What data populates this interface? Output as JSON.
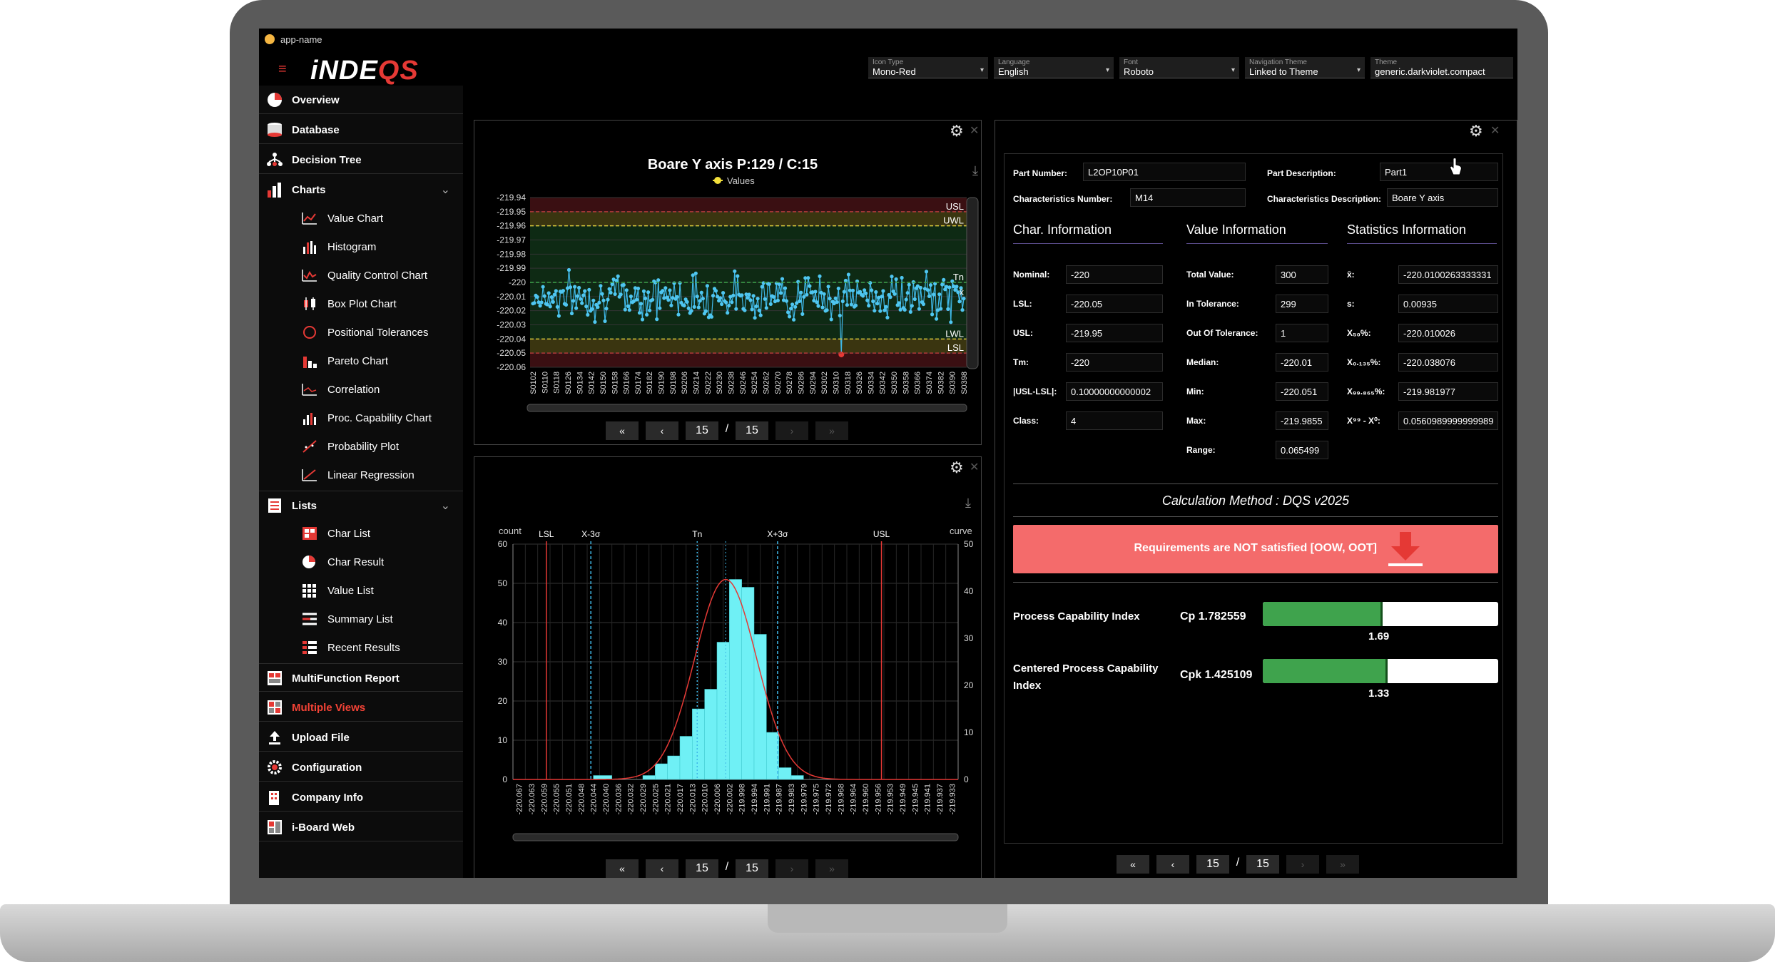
{
  "app": {
    "title": "app-name",
    "logo_main": "iNDE",
    "logo_accent": "QS"
  },
  "top_selectors": [
    {
      "label": "Icon Type",
      "value": "Mono-Red"
    },
    {
      "label": "Language",
      "value": "English"
    },
    {
      "label": "Font",
      "value": "Roboto"
    },
    {
      "label": "Navigation Theme",
      "value": "Linked to Theme"
    },
    {
      "label": "Theme",
      "value": "generic.darkviolet.compact"
    }
  ],
  "sidebar": {
    "overview": "Overview",
    "database": "Database",
    "decision_tree": "Decision Tree",
    "charts": "Charts",
    "chart_items": [
      "Value Chart",
      "Histogram",
      "Quality Control Chart",
      "Box Plot Chart",
      "Positional Tolerances",
      "Pareto Chart",
      "Correlation",
      "Proc. Capability Chart",
      "Probability Plot",
      "Linear Regression"
    ],
    "lists": "Lists",
    "list_items": [
      "Char List",
      "Char Result",
      "Value List",
      "Summary List",
      "Recent Results"
    ],
    "multifunction": "MultiFunction Report",
    "multiple_views": "Multiple Views",
    "upload": "Upload File",
    "configuration": "Configuration",
    "company": "Company Info",
    "iboard": "i-Board Web"
  },
  "value_chart": {
    "title": "Boare Y axis P:129 / C:15",
    "legend": "Values",
    "y_ticks": [
      "-219.94",
      "-219.95",
      "-219.96",
      "-219.97",
      "-219.98",
      "-219.99",
      "-220",
      "-220.01",
      "-220.02",
      "-220.03",
      "-220.04",
      "-220.05",
      "-220.06"
    ],
    "x_ticks": [
      "S0102",
      "S0110",
      "S0118",
      "S0126",
      "S0134",
      "S0142",
      "S0150",
      "S0158",
      "S0166",
      "S0174",
      "S0182",
      "S0190",
      "S0198",
      "S0206",
      "S0214",
      "S0222",
      "S0230",
      "S0238",
      "S0246",
      "S0254",
      "S0262",
      "S0270",
      "S0278",
      "S0286",
      "S0294",
      "S0302",
      "S0310",
      "S0318",
      "S0326",
      "S0334",
      "S0342",
      "S0350",
      "S0358",
      "S0366",
      "S0374",
      "S0382",
      "S0390",
      "S0398"
    ],
    "line_labels": {
      "usl": "USL",
      "uwl": "UWL",
      "tn": "Tn",
      "x": "x̄",
      "lwl": "LWL",
      "lsl": "LSL"
    },
    "pager": {
      "first": "«",
      "prev": "‹",
      "current": "15",
      "sep": "/",
      "total": "15",
      "next": "›",
      "last": "»"
    }
  },
  "histogram": {
    "left_axis_title": "count",
    "right_axis_title": "curve",
    "left_ticks": [
      "60",
      "50",
      "40",
      "30",
      "20",
      "10",
      "0"
    ],
    "right_ticks": [
      "50",
      "40",
      "30",
      "20",
      "10",
      "0"
    ],
    "vlines": {
      "lsl": "LSL",
      "xm3": "X-3σ",
      "tn": "Tn",
      "xp3": "X+3σ",
      "usl": "USL"
    },
    "x_ticks": [
      "-220.067",
      "-220.063",
      "-220.059",
      "-220.055",
      "-220.051",
      "-220.048",
      "-220.044",
      "-220.040",
      "-220.036",
      "-220.032",
      "-220.029",
      "-220.025",
      "-220.021",
      "-220.017",
      "-220.013",
      "-220.010",
      "-220.006",
      "-220.002",
      "-219.998",
      "-219.994",
      "-219.991",
      "-219.987",
      "-219.983",
      "-219.979",
      "-219.975",
      "-219.972",
      "-219.968",
      "-219.964",
      "-219.960",
      "-219.956",
      "-219.953",
      "-219.949",
      "-219.945",
      "-219.941",
      "-219.937",
      "-219.933"
    ],
    "pager": {
      "first": "«",
      "prev": "‹",
      "current": "15",
      "sep": "/",
      "total": "15",
      "next": "›",
      "last": "»"
    }
  },
  "chart_data": [
    {
      "type": "line",
      "title": "Boare Y axis P:129 / C:15",
      "series": [
        {
          "name": "Values"
        }
      ],
      "ylim": [
        -220.06,
        -219.94
      ],
      "limits": {
        "USL": -219.95,
        "UWL": -219.96,
        "Tn": -220.0,
        "LWL": -220.04,
        "LSL": -220.05
      },
      "x_range": [
        "S0102",
        "S0398"
      ]
    },
    {
      "type": "bar",
      "xlabel": "",
      "ylabel": "count",
      "y2label": "curve",
      "ylim": [
        0,
        60
      ],
      "y2lim": [
        0,
        50
      ],
      "categories": [
        "-220.051",
        "-220.036",
        "-220.032",
        "-220.029",
        "-220.025",
        "-220.021",
        "-220.017",
        "-220.013",
        "-220.010",
        "-220.006",
        "-220.002",
        "-219.998",
        "-219.994",
        "-219.991"
      ],
      "values": [
        1,
        1,
        4,
        6,
        11,
        18,
        23,
        35,
        51,
        49,
        37,
        12,
        3,
        1
      ],
      "vlines": {
        "LSL": -220.05,
        "X-3σ": -220.038,
        "Tn": -220.0,
        "X+3σ": -219.982,
        "USL": -219.95
      }
    }
  ],
  "info": {
    "part_number_label": "Part Number:",
    "part_number": "L2OP10P01",
    "part_desc_label": "Part Description:",
    "part_desc": "Part1",
    "char_number_label": "Characteristics Number:",
    "char_number": "M14",
    "char_desc_label": "Characteristics Description:",
    "char_desc": "Boare Y axis",
    "sec_char": "Char. Information",
    "sec_value": "Value Information",
    "sec_stats": "Statistics Information",
    "char_rows": [
      {
        "label": "Nominal:",
        "value": "-220"
      },
      {
        "label": "LSL:",
        "value": "-220.05"
      },
      {
        "label": "USL:",
        "value": "-219.95"
      },
      {
        "label": "Tm:",
        "value": "-220"
      },
      {
        "label": "|USL-LSL|:",
        "value": "0.10000000000002"
      },
      {
        "label": "Class:",
        "value": "4"
      }
    ],
    "value_rows": [
      {
        "label": "Total Value:",
        "value": "300"
      },
      {
        "label": "In Tolerance:",
        "value": "299"
      },
      {
        "label": "Out Of Tolerance:",
        "value": "1"
      },
      {
        "label": "Median:",
        "value": "-220.01"
      },
      {
        "label": "Min:",
        "value": "-220.051"
      },
      {
        "label": "Max:",
        "value": "-219.9855"
      },
      {
        "label": "Range:",
        "value": "0.065499"
      }
    ],
    "stat_rows": [
      {
        "label": "x̄:",
        "value": "-220.0100263333331"
      },
      {
        "label": "s:",
        "value": "0.00935"
      },
      {
        "label": "X₅₀%:",
        "value": "-220.010026"
      },
      {
        "label": "X₀.₁₃₅%:",
        "value": "-220.038076"
      },
      {
        "label": "X₉₉.₈₆₅%:",
        "value": "-219.981977"
      },
      {
        "label": "X⁹⁹ - X⁰:",
        "value": "0.0560989999999989"
      }
    ],
    "calc_method": "Calculation Method : DQS v2025",
    "alert": "Requirements are NOT satisfied [OOW, OOT]",
    "cp_label": "Process Capability Index",
    "cp_value": "Cp 1.782559",
    "cp_threshold": "1.69",
    "cp_fill": 0.51,
    "cpk_label": "Centered Process Capability Index",
    "cpk_value": "Cpk 1.425109",
    "cpk_threshold": "1.33",
    "cpk_fill": 0.53,
    "pager": {
      "first": "«",
      "prev": "‹",
      "current": "15",
      "sep": "/",
      "total": "15",
      "next": "›",
      "last": "»"
    }
  },
  "colors": {
    "accent_red": "#e53935",
    "alert_bg": "#f46b6b",
    "progress_green": "#3fa34d",
    "hist_bar": "#6ff0f5",
    "series": "#3fb8e8",
    "theme_violet": "#5a4b8a"
  }
}
